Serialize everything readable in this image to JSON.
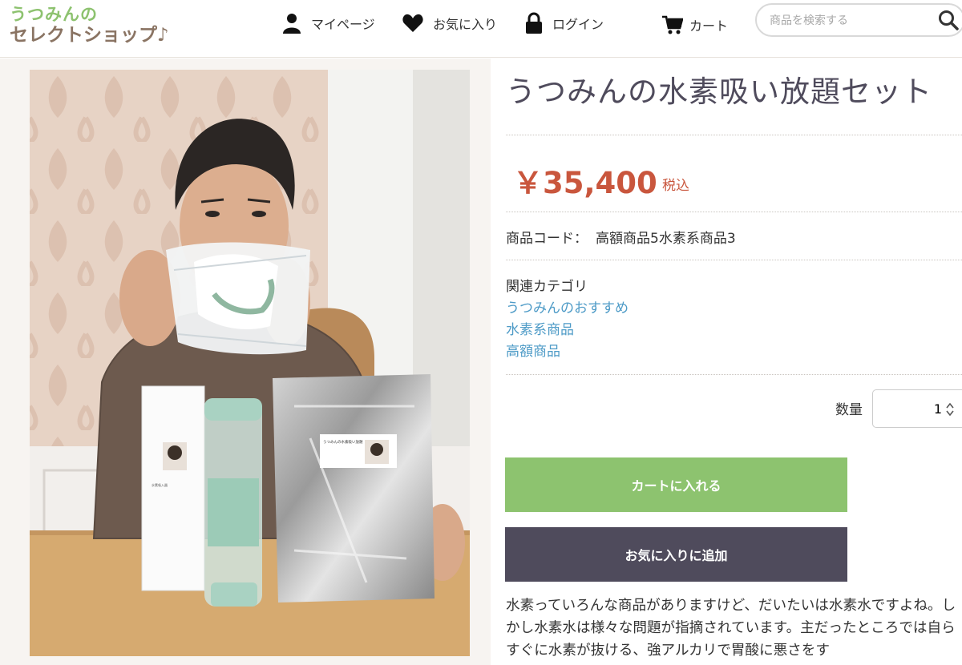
{
  "header": {
    "logo": {
      "line1": "うつみんの",
      "line2": "セレクトショップ♪"
    },
    "nav": [
      {
        "label": "マイページ",
        "icon": "user-icon"
      },
      {
        "label": "お気に入り",
        "icon": "heart-icon"
      },
      {
        "label": "ログイン",
        "icon": "lock-icon"
      },
      {
        "label": "カート",
        "icon": "cart-icon"
      }
    ],
    "search": {
      "placeholder": "商品を検索する",
      "value": "",
      "icon": "search-icon"
    }
  },
  "product": {
    "title": "うつみんの水素吸い放題セット",
    "price": "￥35,400",
    "tax_label": "税込",
    "code_label": "商品コード：",
    "code_value": "高額商品5水素系商品3",
    "category_label": "関連カテゴリ",
    "categories": [
      "うつみんのおすすめ",
      "水素系商品",
      "高額商品"
    ],
    "quantity_label": "数量",
    "quantity_value": "1",
    "add_to_cart": "カートに入れる",
    "add_to_favorites": "お気に入りに追加",
    "description": "水素っていろんな商品がありますけど、だいたいは水素水ですよね。しかし水素水は様々な問題が指摘されています。主だったところでは自らすぐに水素が抜ける、強アルカリで胃酸に悪さをす"
  },
  "photo": {
    "label_text": "うつみんの水素吸い放題",
    "subject": "man holding hydrogen inhaler set"
  },
  "colors": {
    "accent_green": "#8dc36f",
    "dark_button": "#4f4b5c",
    "price_red": "#c9563d",
    "link_blue": "#4e9bc7",
    "logo_brown": "#8a7463"
  }
}
